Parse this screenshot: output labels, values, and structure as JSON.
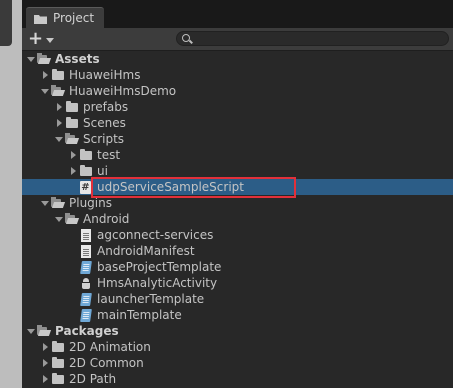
{
  "window": {
    "tab_title": "Project"
  },
  "toolbar": {
    "add_symbol": "+",
    "search_placeholder": "",
    "search_value": ""
  },
  "tree": [
    {
      "label": "Assets",
      "depth": 0,
      "expanded": true,
      "icon": "folder-open-icon",
      "bold": true
    },
    {
      "label": "HuaweiHms",
      "depth": 1,
      "expanded": false,
      "icon": "folder-icon"
    },
    {
      "label": "HuaweiHmsDemo",
      "depth": 1,
      "expanded": true,
      "icon": "folder-open-icon"
    },
    {
      "label": "prefabs",
      "depth": 2,
      "expanded": false,
      "icon": "folder-icon"
    },
    {
      "label": "Scenes",
      "depth": 2,
      "expanded": false,
      "icon": "folder-icon"
    },
    {
      "label": "Scripts",
      "depth": 2,
      "expanded": true,
      "icon": "folder-open-icon"
    },
    {
      "label": "test",
      "depth": 3,
      "expanded": false,
      "icon": "folder-icon"
    },
    {
      "label": "ui",
      "depth": 3,
      "expanded": false,
      "icon": "folder-icon"
    },
    {
      "label": "udpServiceSampleScript",
      "depth": 3,
      "leaf": true,
      "icon": "csharp-script-icon",
      "selected": true
    },
    {
      "label": "Plugins",
      "depth": 1,
      "expanded": true,
      "icon": "folder-open-icon"
    },
    {
      "label": "Android",
      "depth": 2,
      "expanded": true,
      "icon": "folder-open-icon"
    },
    {
      "label": "agconnect-services",
      "depth": 3,
      "leaf": true,
      "icon": "document-icon"
    },
    {
      "label": "AndroidManifest",
      "depth": 3,
      "leaf": true,
      "icon": "document-icon"
    },
    {
      "label": "baseProjectTemplate",
      "depth": 3,
      "leaf": true,
      "icon": "text-asset-icon"
    },
    {
      "label": "HmsAnalyticActivity",
      "depth": 3,
      "leaf": true,
      "icon": "android-icon"
    },
    {
      "label": "launcherTemplate",
      "depth": 3,
      "leaf": true,
      "icon": "text-asset-icon"
    },
    {
      "label": "mainTemplate",
      "depth": 3,
      "leaf": true,
      "icon": "text-asset-icon"
    },
    {
      "label": "Packages",
      "depth": 0,
      "expanded": true,
      "icon": "folder-open-icon",
      "bold": true
    },
    {
      "label": "2D Animation",
      "depth": 1,
      "expanded": false,
      "icon": "folder-icon"
    },
    {
      "label": "2D Common",
      "depth": 1,
      "expanded": false,
      "icon": "folder-icon"
    },
    {
      "label": "2D Path",
      "depth": 1,
      "expanded": false,
      "icon": "folder-icon"
    }
  ],
  "colors": {
    "panel_bg": "#282828",
    "selection": "#2c5d87",
    "highlight_outline": "#e2303a",
    "text": "#c4c4c4"
  }
}
